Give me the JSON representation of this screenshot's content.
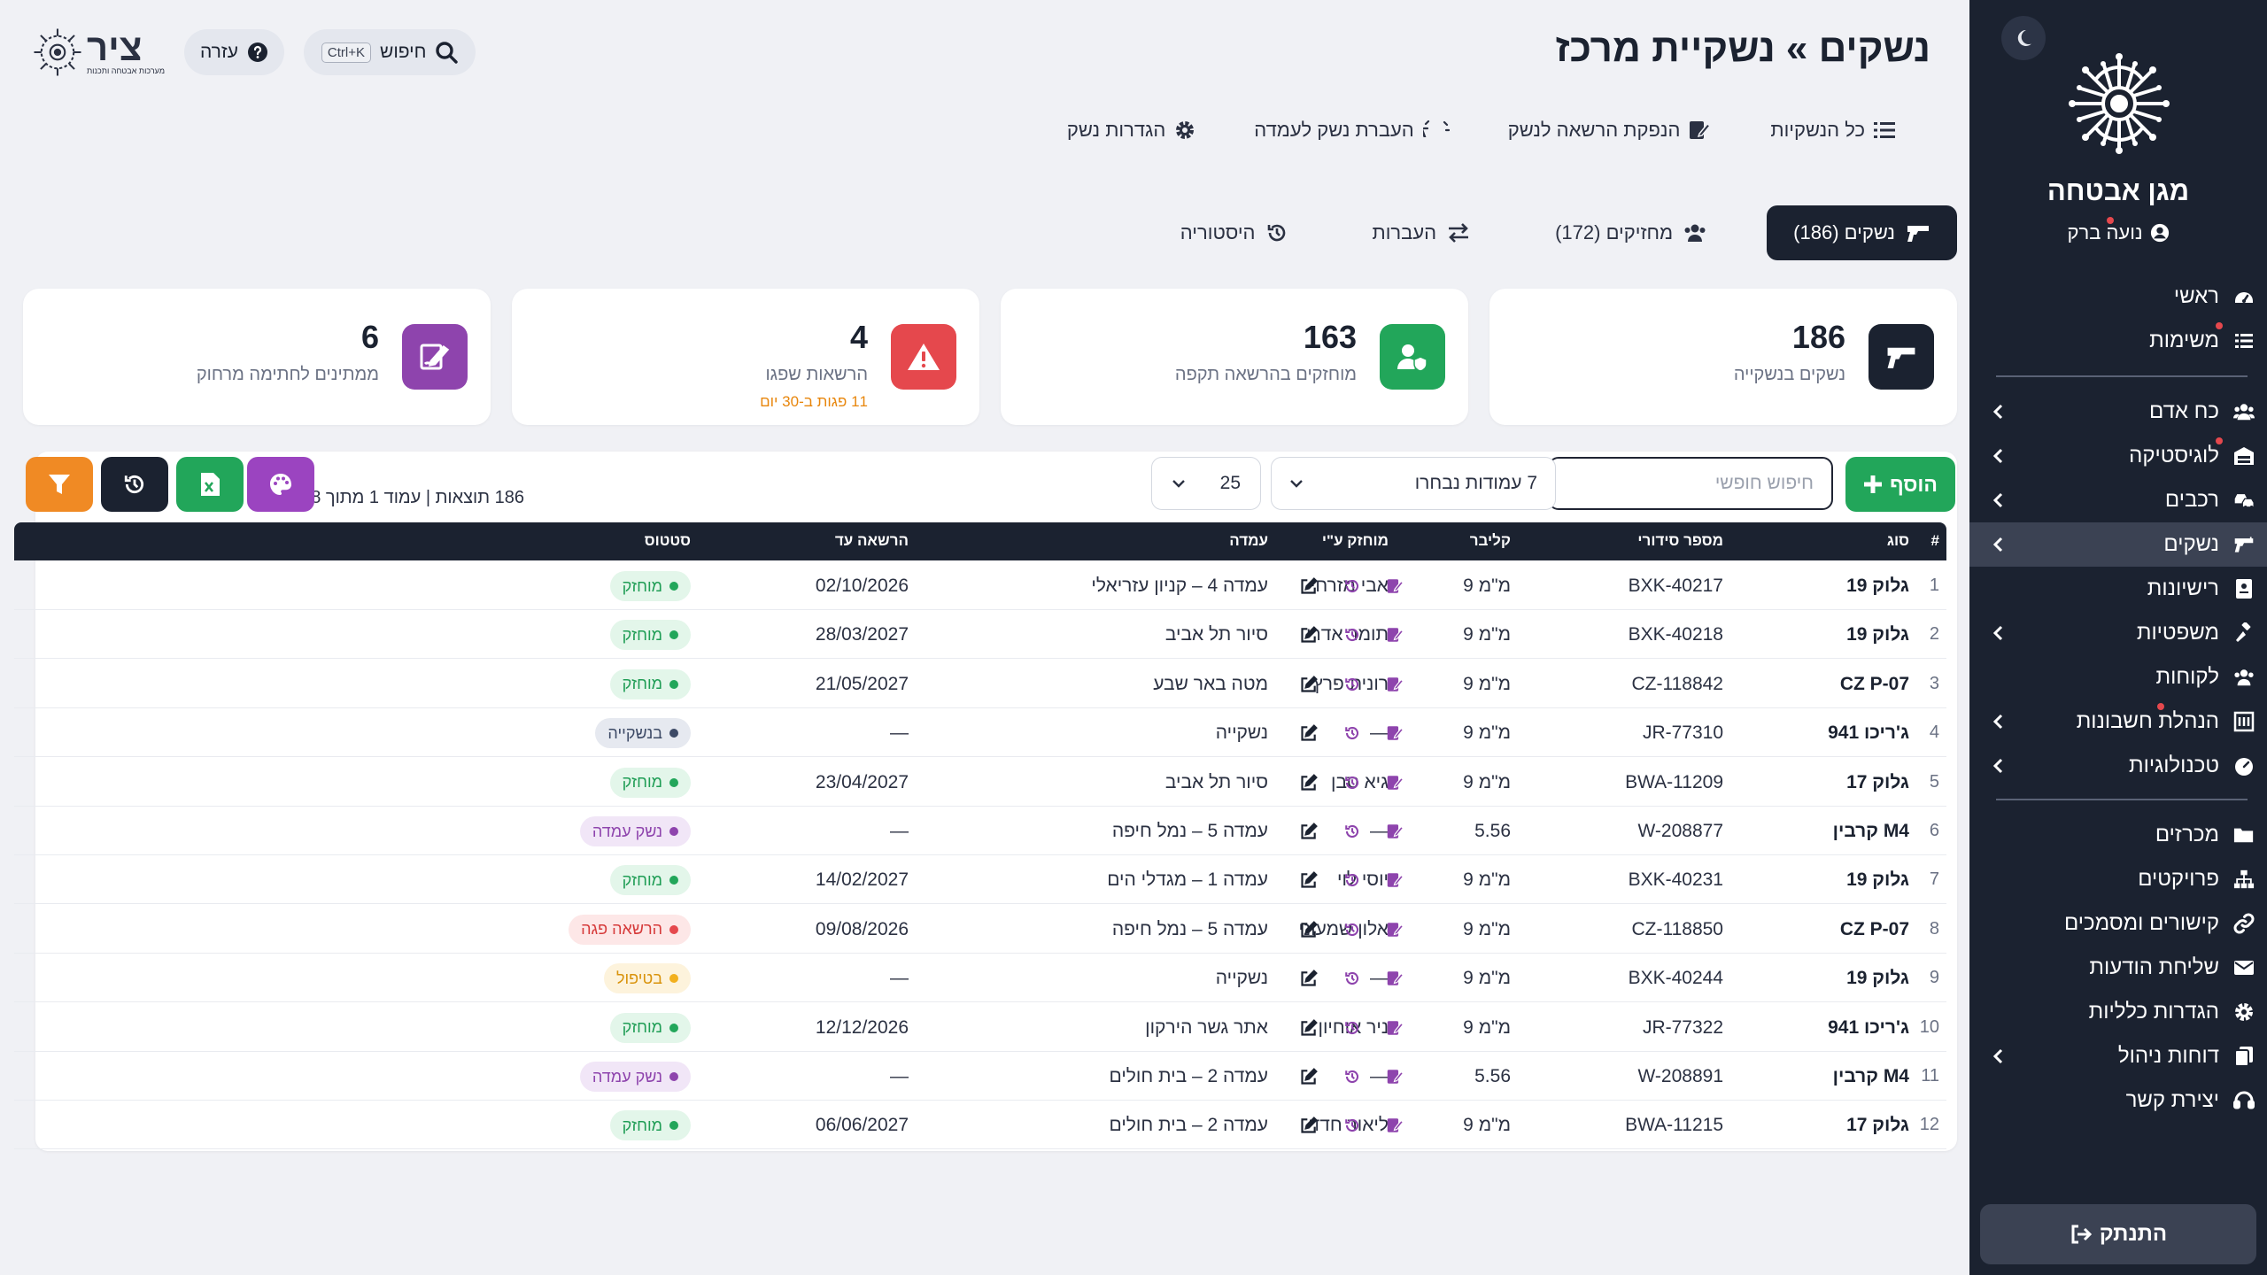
{
  "sidebar": {
    "brand_name": "מגן אבטחה",
    "user_name": "נועה ברק",
    "items": [
      {
        "label": "ראשי",
        "icon": "dashboard-icon"
      },
      {
        "label": "משימות",
        "icon": "tasks-icon"
      },
      {
        "label": "כח אדם",
        "icon": "users-icon"
      },
      {
        "label": "לוגיסטיקה",
        "icon": "warehouse-icon"
      },
      {
        "label": "רכבים",
        "icon": "cars-icon"
      },
      {
        "label": "נשקים",
        "icon": "gun-icon"
      },
      {
        "label": "רישיונות",
        "icon": "id-card-icon"
      },
      {
        "label": "משפטיות",
        "icon": "gavel-icon"
      },
      {
        "label": "לקוחות",
        "icon": "clients-icon"
      },
      {
        "label": "הנהלת חשבונות",
        "icon": "accounting-icon"
      },
      {
        "label": "טכנולוגיות",
        "icon": "technology-icon"
      },
      {
        "label": "מכרזים",
        "icon": "folder-icon"
      },
      {
        "label": "פרויקטים",
        "icon": "sitemap-icon"
      },
      {
        "label": "קישורים ומסמכים",
        "icon": "link-icon"
      },
      {
        "label": "שליחת הודעות",
        "icon": "envelope-icon"
      },
      {
        "label": "הגדרות כלליות",
        "icon": "settings-icon"
      },
      {
        "label": "דוחות ניהול",
        "icon": "reports-icon"
      },
      {
        "label": "יצירת קשר",
        "icon": "headset-icon"
      }
    ],
    "logout_label": "התנתק"
  },
  "header": {
    "title": "נשקים » נשקיית מרכז",
    "search_label": "חיפוש",
    "search_shortcut": "Ctrl+K",
    "help_label": "עזרה",
    "logo_text": "ציר",
    "logo_subtext": "מערכות אבטחה ותכנות"
  },
  "actions": [
    {
      "label": "כל הנשקיות",
      "icon": "list-icon"
    },
    {
      "label": "הנפקת הרשאה לנשק",
      "icon": "sign-icon"
    },
    {
      "label": "העברת נשק לעמדה",
      "icon": "transfer-weapon-icon"
    },
    {
      "label": "הגדרות נשק",
      "icon": "gear-icon"
    }
  ],
  "tabs": [
    {
      "label": "נשקים (186)",
      "icon": "gun-icon",
      "active": true
    },
    {
      "label": "מחזיקים (172)",
      "icon": "users-icon",
      "active": false
    },
    {
      "label": "העברות",
      "icon": "exchange-icon",
      "active": false
    },
    {
      "label": "היסטוריה",
      "icon": "history-icon",
      "active": false
    }
  ],
  "stats": [
    {
      "value": "186",
      "label": "נשקים בנשקייה",
      "sub": "",
      "color": "#1b2230",
      "icon": "gun-icon"
    },
    {
      "value": "163",
      "label": "מוחזקים בהרשאה תקפה",
      "sub": "",
      "color": "#22a65a",
      "icon": "user-shield-icon"
    },
    {
      "value": "4",
      "label": "הרשאות שפגו",
      "sub": "11 פגות ב-30 יום",
      "color": "#e5484d",
      "icon": "warning-icon"
    },
    {
      "value": "6",
      "label": "ממתינים לחתימה מרחוק",
      "sub": "",
      "color": "#8e44ad",
      "icon": "signature-icon"
    }
  ],
  "toolbar": {
    "add_label": "הוסף",
    "search_placeholder": "חיפוש חופשי",
    "columns_select": "7 עמודות נבחרו",
    "page_size": "25",
    "results_info": "186 תוצאות | עמוד 1 מתוך 8"
  },
  "table": {
    "columns": [
      "#",
      "סוג",
      "מספר סידורי",
      "קליבר",
      "מוחזק ע\"י",
      "עמדה",
      "הרשאה עד",
      "סטטוס"
    ],
    "rows": [
      {
        "num": "1",
        "type": "גלוק 19",
        "serial": "BXK-40217",
        "caliber": "9 מ\"מ",
        "holder": "אבי מזרחי",
        "post": "עמדה 4 – קניון עזריאלי",
        "expiry": "02/10/2026",
        "status": "מוחזק",
        "status_kind": "held"
      },
      {
        "num": "2",
        "type": "גלוק 19",
        "serial": "BXK-40218",
        "caliber": "9 מ\"מ",
        "holder": "תומר אדרי",
        "post": "סיור תל אביב",
        "expiry": "28/03/2027",
        "status": "מוחזק",
        "status_kind": "held"
      },
      {
        "num": "3",
        "type": "CZ P-07",
        "serial": "CZ-118842",
        "caliber": "9 מ\"מ",
        "holder": "רונית פרץ",
        "post": "מטה באר שבע",
        "expiry": "21/05/2027",
        "status": "מוחזק",
        "status_kind": "held"
      },
      {
        "num": "4",
        "type": "ג'ריכו 941",
        "serial": "JR-77310",
        "caliber": "9 מ\"מ",
        "holder": "—",
        "post": "נשקייה",
        "expiry": "—",
        "status": "בנשקייה",
        "status_kind": "armory"
      },
      {
        "num": "5",
        "type": "גלוק 17",
        "serial": "BWA-11209",
        "caliber": "9 מ\"מ",
        "holder": "גיא סבן",
        "post": "סיור תל אביב",
        "expiry": "23/04/2027",
        "status": "מוחזק",
        "status_kind": "held"
      },
      {
        "num": "6",
        "type": "קרבין M4",
        "serial": "W-208877",
        "caliber": "5.56",
        "holder": "—",
        "post": "עמדה 5 – נמל חיפה",
        "expiry": "—",
        "status": "נשק עמדה",
        "status_kind": "post"
      },
      {
        "num": "7",
        "type": "גלוק 19",
        "serial": "BXK-40231",
        "caliber": "9 מ\"מ",
        "holder": "יוסי לוי",
        "post": "עמדה 1 – מגדלי הים",
        "expiry": "14/02/2027",
        "status": "מוחזק",
        "status_kind": "held"
      },
      {
        "num": "8",
        "type": "CZ P-07",
        "serial": "CZ-118850",
        "caliber": "9 מ\"מ",
        "holder": "אלון שמעוני",
        "post": "עמדה 5 – נמל חיפה",
        "expiry": "09/08/2026",
        "status": "הרשאה פגה",
        "status_kind": "expired"
      },
      {
        "num": "9",
        "type": "גלוק 19",
        "serial": "BXK-40244",
        "caliber": "9 מ\"מ",
        "holder": "—",
        "post": "נשקייה",
        "expiry": "—",
        "status": "בטיפול",
        "status_kind": "service"
      },
      {
        "num": "10",
        "type": "ג'ריכו 941",
        "serial": "JR-77322",
        "caliber": "9 מ\"מ",
        "holder": "ניר אוחיון",
        "post": "אתר גשר הירקון",
        "expiry": "12/12/2026",
        "status": "מוחזק",
        "status_kind": "held"
      },
      {
        "num": "11",
        "type": "קרבין M4",
        "serial": "W-208891",
        "caliber": "5.56",
        "holder": "—",
        "post": "עמדה 2 – בית חולים",
        "expiry": "—",
        "status": "נשק עמדה",
        "status_kind": "post"
      },
      {
        "num": "12",
        "type": "גלוק 17",
        "serial": "BWA-11215",
        "caliber": "9 מ\"מ",
        "holder": "ליאור חדד",
        "post": "עמדה 2 – בית חולים",
        "expiry": "06/06/2027",
        "status": "מוחזק",
        "status_kind": "held"
      }
    ]
  },
  "status_styles": {
    "held": {
      "bg": "#e3f6ea",
      "fg": "#1f9d55",
      "dot": "#22a65a"
    },
    "armory": {
      "bg": "#e6e9f0",
      "fg": "#3d4a66",
      "dot": "#3d4a66"
    },
    "post": {
      "bg": "#f1e6f7",
      "fg": "#8e44ad",
      "dot": "#8e44ad"
    },
    "expired": {
      "bg": "#fde7e7",
      "fg": "#d63a3a",
      "dot": "#e5484d"
    },
    "service": {
      "bg": "#fdf3dc",
      "fg": "#d9930c",
      "dot": "#f2b01e"
    }
  },
  "colors": {
    "sidebar_bg": "#1b2230",
    "accent_green": "#22a65a",
    "accent_orange": "#f08a24",
    "accent_purple": "#9b44c0",
    "accent_red": "#e5484d"
  }
}
